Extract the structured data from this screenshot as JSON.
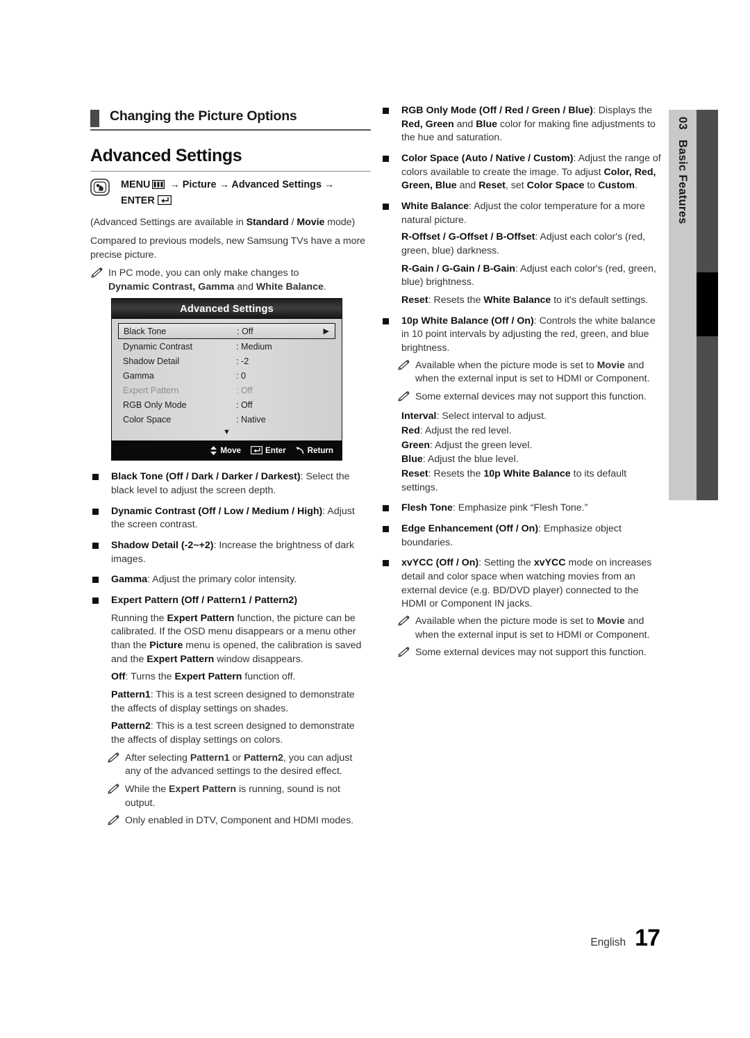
{
  "chapter_tab": {
    "number": "03",
    "name": "Basic Features"
  },
  "footer": {
    "language": "English",
    "page_number": "17"
  },
  "left_column": {
    "section_title": "Changing the Picture Options",
    "heading": "Advanced Settings",
    "menu_path": {
      "menu_label": "MENU",
      "arrow1": "→",
      "picture_label": "Picture",
      "arrow2": "→",
      "advanced_label": "Advanced Settings",
      "arrow3": "→",
      "enter_label": "ENTER"
    },
    "intro": [
      "(Advanced Settings are available in  Standard / Movie mode)",
      "Compared to previous models, new Samsung TVs have a more precise picture."
    ],
    "intro_note": "In PC mode, you can only make changes to Dynamic Contrast, Gamma and White Balance.",
    "osd": {
      "title": "Advanced Settings",
      "rows": [
        {
          "label": "Black Tone",
          "value": ": Off",
          "selected": true,
          "dim": false,
          "arrow": "▶"
        },
        {
          "label": "Dynamic Contrast",
          "value": ": Medium",
          "selected": false,
          "dim": false,
          "arrow": ""
        },
        {
          "label": "Shadow Detail",
          "value": ": -2",
          "selected": false,
          "dim": false,
          "arrow": ""
        },
        {
          "label": "Gamma",
          "value": ": 0",
          "selected": false,
          "dim": false,
          "arrow": ""
        },
        {
          "label": "Expert Pattern",
          "value": ": Off",
          "selected": false,
          "dim": true,
          "arrow": ""
        },
        {
          "label": "RGB Only Mode",
          "value": ": Off",
          "selected": false,
          "dim": false,
          "arrow": ""
        },
        {
          "label": "Color Space",
          "value": ": Native",
          "selected": false,
          "dim": false,
          "arrow": ""
        }
      ],
      "scroll_down": "▼",
      "footer": {
        "move": "Move",
        "enter": "Enter",
        "return": "Return"
      }
    },
    "bullets": {
      "black_tone_title": "Black Tone (Off / Dark / Darker / Darkest)",
      "black_tone_body": ": Select the black level to adjust the screen depth.",
      "dynamic_contrast_title": "Dynamic Contrast (Off / Low / Medium / High)",
      "dynamic_contrast_body": ": Adjust the screen contrast.",
      "shadow_detail_title": "Shadow Detail (-2~+2)",
      "shadow_detail_body": ": Increase the brightness of dark images.",
      "gamma_title": "Gamma",
      "gamma_body": ": Adjust the primary color intensity.",
      "expert_pattern_title": "Expert Pattern (Off / Pattern1 / Pattern2)"
    },
    "expert_pattern": {
      "para1_a": "Running the ",
      "para1_b": "Expert Pattern",
      "para1_c": " function, the picture can be calibrated. If the OSD menu disappears or a menu other than the ",
      "para1_d": "Picture",
      "para1_e": " menu is opened, the calibration is saved and the ",
      "para1_f": "Expert Pattern",
      "para1_g": " window disappears.",
      "off_label": "Off",
      "off_body_a": ": Turns the ",
      "off_body_b": "Expert Pattern",
      "off_body_c": " function off.",
      "pattern1_label": "Pattern1",
      "pattern1_body": ": This is a test screen designed to demonstrate the affects of display settings on shades.",
      "pattern2_label": "Pattern2",
      "pattern2_body": ": This is a test screen designed to demonstrate the affects of display settings on colors.",
      "note1_a": "After selecting ",
      "note1_b": "Pattern1",
      "note1_c": " or ",
      "note1_d": "Pattern2",
      "note1_e": ", you can adjust any of the advanced settings to the desired effect.",
      "note2_a": "While the ",
      "note2_b": "Expert Pattern",
      "note2_c": " is running, sound is not output.",
      "note3": "Only enabled in DTV, Component and HDMI modes."
    }
  },
  "right_column": {
    "rgb_only": {
      "title": "RGB Only Mode (Off / Red / Green / Blue)",
      "body_a": ": Displays the ",
      "body_b": "Red, Green",
      "body_c": " and ",
      "body_d": "Blue",
      "body_e": " color for making fine adjustments to the hue and saturation."
    },
    "color_space": {
      "title": "Color Space (Auto / Native / Custom)",
      "body_a": ": Adjust the range of colors available to create the image. To adjust ",
      "body_b": "Color, Red, Green, Blue",
      "body_c": " and ",
      "body_d": "Reset",
      "body_e": ", set ",
      "body_f": "Color Space",
      "body_g": " to ",
      "body_h": "Custom",
      "body_i": "."
    },
    "white_balance": {
      "title": "White Balance",
      "body": ": Adjust the color temperature for a more natural picture.",
      "offset_label": "R-Offset / G-Offset / B-Offset",
      "offset_body": ": Adjust each color's (red, green, blue) darkness.",
      "gain_label": "R-Gain / G-Gain / B-Gain",
      "gain_body": ": Adjust each color's (red, green, blue) brightness.",
      "reset_label": "Reset",
      "reset_body_a": ": Resets the ",
      "reset_body_b": "White Balance",
      "reset_body_c": " to it's default settings."
    },
    "ten_p_white_balance": {
      "title": "10p White Balance (Off / On)",
      "body": ": Controls the white balance in 10 point intervals by adjusting the red, green, and blue brightness.",
      "note1_a": "Available when the picture mode is set to ",
      "note1_b": "Movie",
      "note1_c": " and when the external input is set to HDMI or Component.",
      "note2": "Some external devices may not support this function.",
      "interval_label": "Interval",
      "interval_body": ": Select interval to adjust.",
      "red_label": "Red",
      "red_body": ": Adjust the red level.",
      "green_label": "Green",
      "green_body": ": Adjust the green level.",
      "blue_label": "Blue",
      "blue_body": ": Adjust the blue level.",
      "reset_label": "Reset",
      "reset_body_a": ": Resets the ",
      "reset_body_b": "10p White Balance",
      "reset_body_c": " to its default settings."
    },
    "flesh_tone": {
      "title": "Flesh Tone",
      "body": ": Emphasize pink “Flesh Tone.”"
    },
    "edge_enhancement": {
      "title": "Edge Enhancement (Off / On)",
      "body": ": Emphasize object boundaries."
    },
    "xvycc": {
      "title": "xvYCC (Off / On)",
      "body_a": ": Setting the ",
      "body_b": "xvYCC",
      "body_c": " mode on increases detail and color space when watching movies from an external device (e.g. BD/DVD player) connected to the HDMI or Component IN jacks.",
      "note1_a": "Available when the picture mode is set to ",
      "note1_b": "Movie",
      "note1_c": " and when the external input is set to HDMI or Component.",
      "note2": "Some external devices may not support this function."
    }
  }
}
